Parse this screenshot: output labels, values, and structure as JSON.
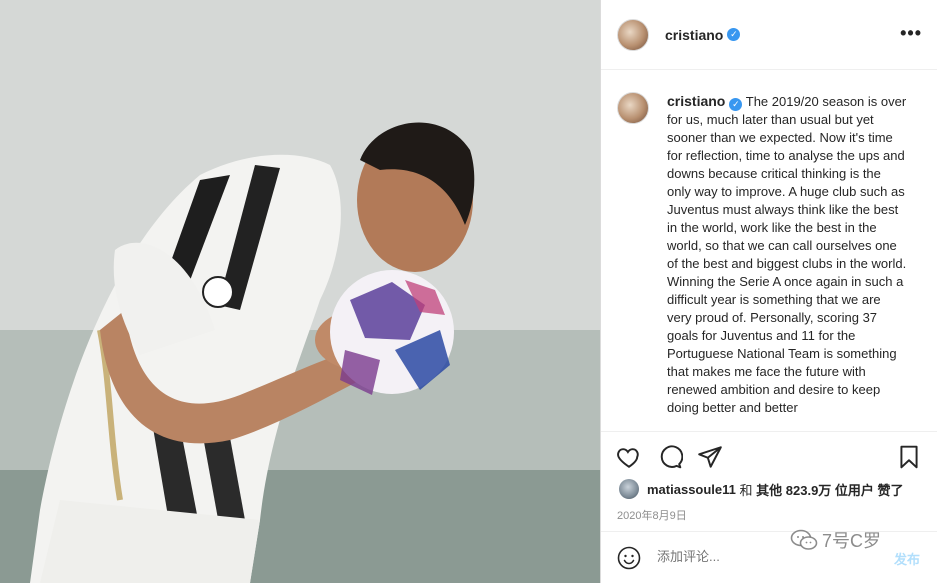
{
  "post": {
    "username": "cristiano",
    "verified_mark": "✓",
    "more_label": "•••",
    "caption": "The 2019/20 season is over for us, much later than usual but yet sooner than we expected. Now it's time for reflection, time to analyse the ups and downs because critical thinking is the only way to improve. A huge club such as Juventus must always think like the best in the world, work like the best in the world, so that we can call ourselves one of the best and biggest clubs in the world. Winning the Serie A once again in such a difficult year is something that we are very proud of. Personally, scoring 37 goals for Juventus and 11 for the Portuguese National Team is something that makes me face the future with renewed ambition and desire to keep doing better and better",
    "likes": {
      "user": "matiassoule11",
      "connector": "和",
      "others": "其他 823.9万 位用户",
      "suffix": "赞了"
    },
    "date": "2020年8月9日"
  },
  "comment_box": {
    "placeholder": "添加评论...",
    "post_label": "发布"
  },
  "watermark": {
    "text": "7号C罗"
  },
  "icons": [
    "heart-icon",
    "comment-icon",
    "share-icon",
    "bookmark-icon",
    "emoji-icon",
    "more-icon"
  ],
  "colors": {
    "verified": "#3897f0",
    "post_button": "#b2dffc",
    "muted": "#8e8e8e"
  }
}
